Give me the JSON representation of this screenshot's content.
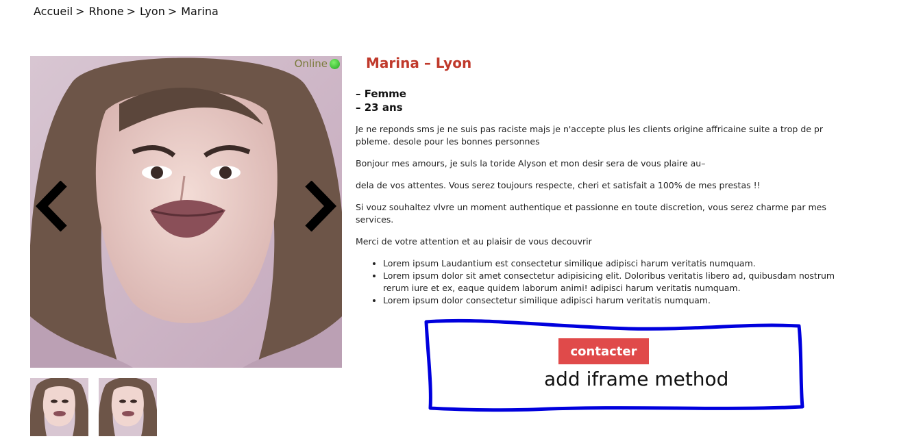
{
  "breadcrumb": {
    "items": [
      "Accueil",
      "Rhone",
      "Lyon",
      "Marina"
    ],
    "separator": ">"
  },
  "gallery": {
    "status_label": "Online",
    "status_color": "#22aa22",
    "prev_icon": "chevron-left-icon",
    "next_icon": "chevron-right-icon"
  },
  "profile": {
    "title": "Marina – Lyon",
    "gender": "– Femme",
    "age": "– 23 ans",
    "paragraphs": [
      "Je ne reponds sms je ne suis pas raciste majs je n'accepte plus les clients origine affricaine suite a trop de pr pbleme. desole pour les bonnes personnes",
      "Bonjour mes amours, je suls la toride Alyson et mon desir sera de vous plaire au–",
      "dela de vos attentes. Vous serez toujours respecte, cheri et satisfait a 100% de mes prestas !!",
      "Si vouz souhaltez vlvre un moment authentique et passionne en toute discretion, vous serez charme par mes services.",
      "Merci de votre attention et au plaisir de vous decouvrir"
    ],
    "bullets": [
      "Lorem ipsum Laudantium est consectetur similique adipisci harum veritatis numquam.",
      "Lorem ipsum dolor sit amet consectetur adipisicing elit. Doloribus veritatis libero ad, quibusdam nostrum rerum iure et ex, eaque quidem laborum animi! adipisci harum veritatis numquam.",
      "Lorem ipsum dolor consectetur similique adipisci harum veritatis numquam."
    ]
  },
  "contact": {
    "button_label": "contacter",
    "button_color": "#e04a4a",
    "annotation": "add iframe method",
    "annotation_border_color": "#0000dd"
  }
}
